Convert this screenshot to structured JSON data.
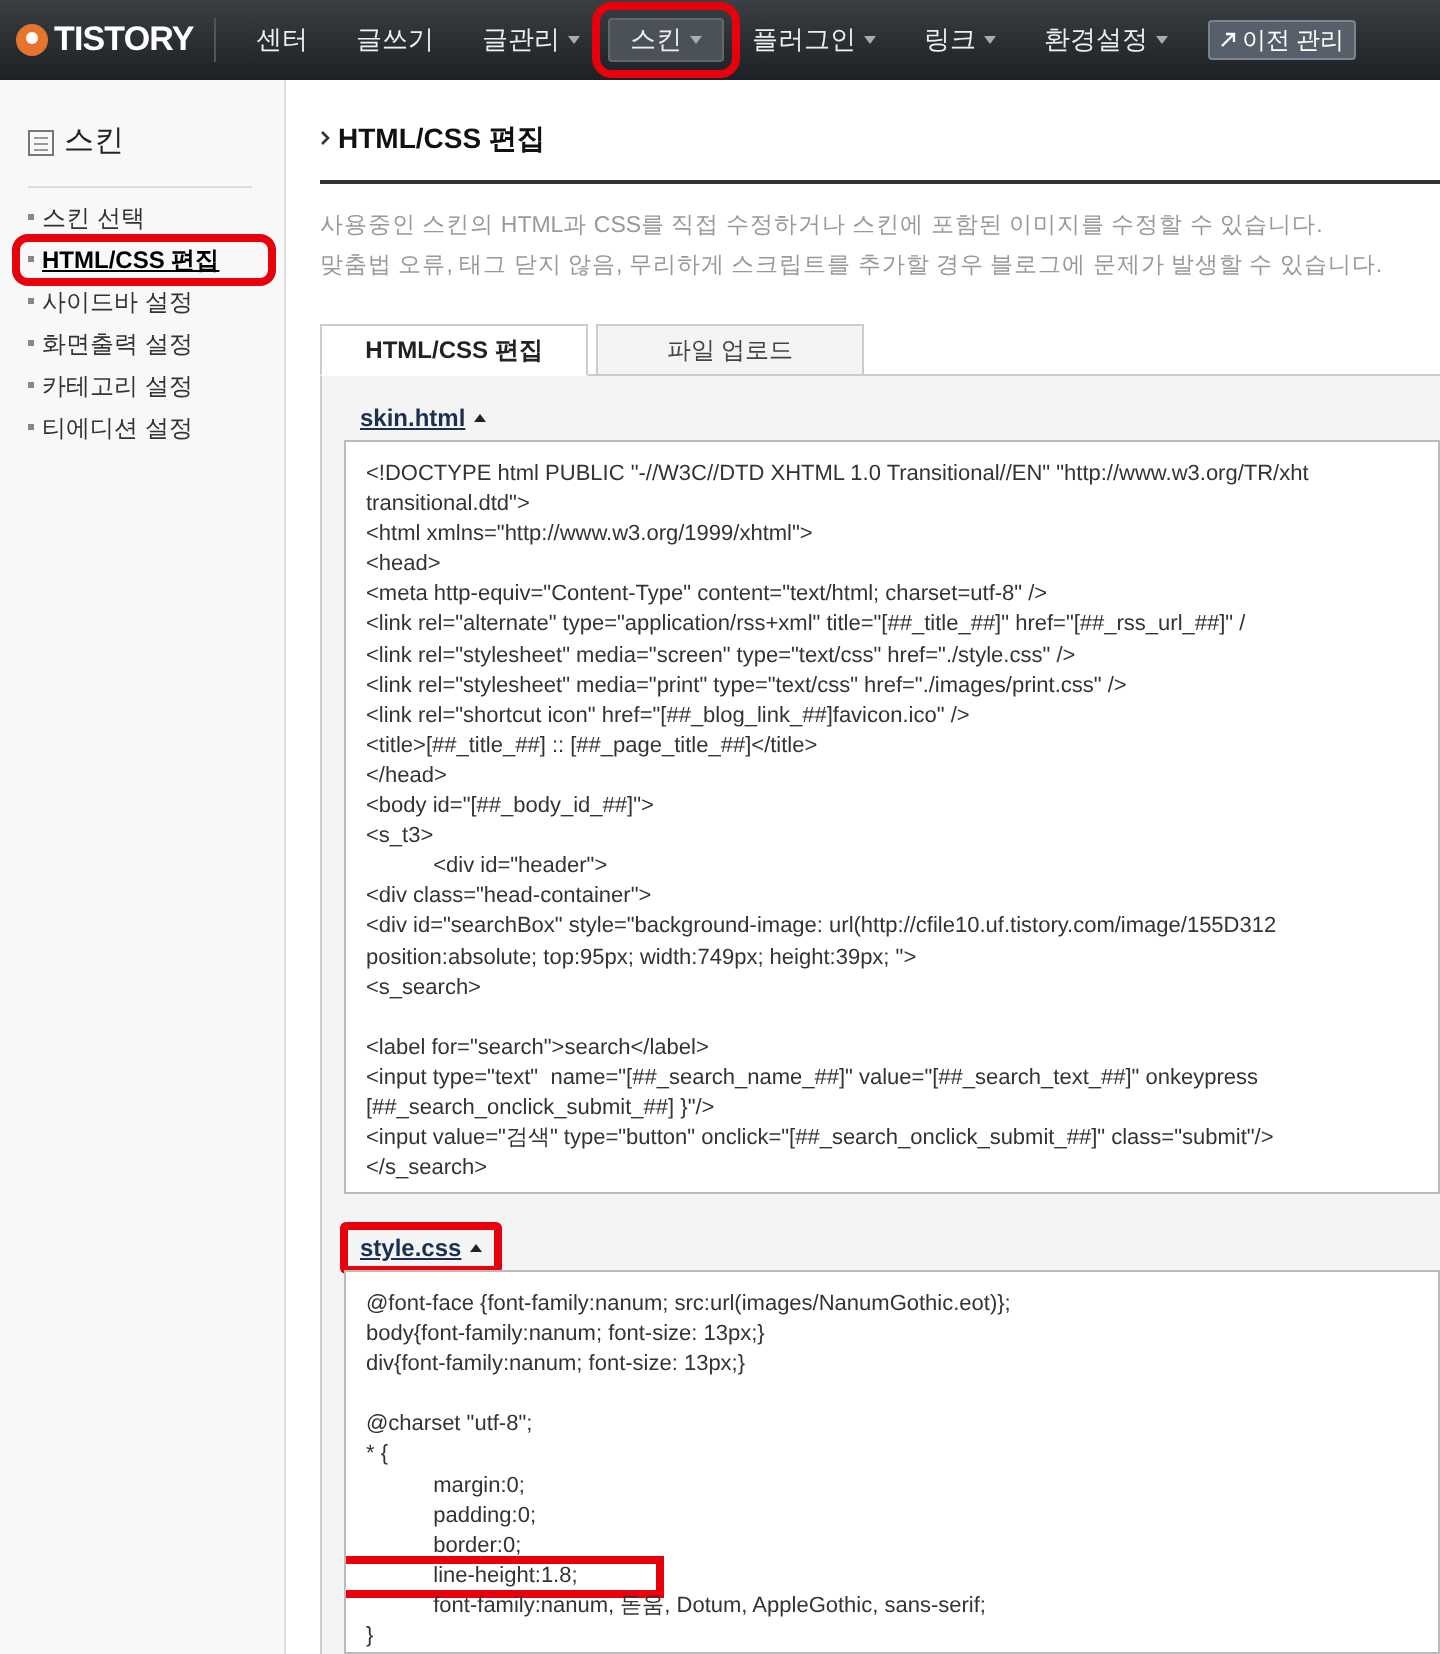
{
  "nav": {
    "logo": "TISTORY",
    "items": [
      {
        "label": "센터",
        "dropdown": false,
        "selected": false,
        "highlighted": false
      },
      {
        "label": "글쓰기",
        "dropdown": false,
        "selected": false,
        "highlighted": false
      },
      {
        "label": "글관리",
        "dropdown": true,
        "selected": false,
        "highlighted": false
      },
      {
        "label": "스킨",
        "dropdown": true,
        "selected": true,
        "highlighted": true
      },
      {
        "label": "플러그인",
        "dropdown": true,
        "selected": false,
        "highlighted": false
      },
      {
        "label": "링크",
        "dropdown": true,
        "selected": false,
        "highlighted": false
      },
      {
        "label": "환경설정",
        "dropdown": true,
        "selected": false,
        "highlighted": false
      }
    ],
    "legacy_button": "이전 관리"
  },
  "sidebar": {
    "title": "스킨",
    "items": [
      {
        "label": "스킨 선택",
        "selected": false,
        "highlighted": false
      },
      {
        "label": "HTML/CSS 편집",
        "selected": true,
        "highlighted": true
      },
      {
        "label": "사이드바 설정",
        "selected": false,
        "highlighted": false
      },
      {
        "label": "화면출력 설정",
        "selected": false,
        "highlighted": false
      },
      {
        "label": "카테고리 설정",
        "selected": false,
        "highlighted": false
      },
      {
        "label": "티에디션 설정",
        "selected": false,
        "highlighted": false
      }
    ]
  },
  "page": {
    "title": "HTML/CSS 편집",
    "description": [
      "사용중인 스킨의 HTML과 CSS를 직접 수정하거나 스킨에 포함된 이미지를 수정할 수 있습니다.",
      "맞춤법 오류, 태그 닫지 않음, 무리하게 스크립트를 추가할 경우 블로그에 문제가 발생할 수 있습니다."
    ],
    "tabs": [
      {
        "label": "HTML/CSS 편집",
        "selected": true
      },
      {
        "label": "파일 업로드",
        "selected": false
      }
    ],
    "sections": [
      {
        "file": "skin.html",
        "highlighted": false,
        "lines": [
          {
            "kind": "code",
            "text": "<!DOCTYPE html PUBLIC \"-//W3C//DTD XHTML 1.0 Transitional//EN\" \"http://www.w3.org/TR/xht",
            "highlighted": false
          },
          {
            "kind": "code",
            "text": "transitional.dtd\">",
            "highlighted": false
          },
          {
            "kind": "code",
            "text": "<html xmlns=\"http://www.w3.org/1999/xhtml\">",
            "highlighted": false
          },
          {
            "kind": "code",
            "text": "<head>",
            "highlighted": false
          },
          {
            "kind": "code",
            "text": "<meta http-equiv=\"Content-Type\" content=\"text/html; charset=utf-8\" />",
            "highlighted": false
          },
          {
            "kind": "code",
            "text": "<link rel=\"alternate\" type=\"application/rss+xml\" title=\"[##_title_##]\" href=\"[##_rss_url_##]\" /",
            "highlighted": false
          },
          {
            "kind": "code",
            "text": "<link rel=\"stylesheet\" media=\"screen\" type=\"text/css\" href=\"./style.css\" />",
            "highlighted": false
          },
          {
            "kind": "code",
            "text": "<link rel=\"stylesheet\" media=\"print\" type=\"text/css\" href=\"./images/print.css\" />",
            "highlighted": false
          },
          {
            "kind": "code",
            "text": "<link rel=\"shortcut icon\" href=\"[##_blog_link_##]favicon.ico\" />",
            "highlighted": false
          },
          {
            "kind": "code",
            "text": "<title>[##_title_##] :: [##_page_title_##]</title>",
            "highlighted": false
          },
          {
            "kind": "code",
            "text": "</head>",
            "highlighted": false
          },
          {
            "kind": "code",
            "text": "<body id=\"[##_body_id_##]\">",
            "highlighted": false
          },
          {
            "kind": "code",
            "text": "<s_t3>",
            "highlighted": false
          },
          {
            "kind": "code",
            "text": "\t<div id=\"header\">",
            "highlighted": false
          },
          {
            "kind": "code",
            "text": "<div class=\"head-container\">",
            "highlighted": false
          },
          {
            "kind": "code",
            "text": "<div id=\"searchBox\" style=\"background-image: url(http://cfile10.uf.tistory.com/image/155D312",
            "highlighted": false
          },
          {
            "kind": "code",
            "text": "position:absolute; top:95px; width:749px; height:39px; \">",
            "highlighted": false
          },
          {
            "kind": "code",
            "text": "<s_search>",
            "highlighted": false
          },
          {
            "kind": "blank"
          },
          {
            "kind": "code",
            "text": "<label for=\"search\">search</label>",
            "highlighted": false
          },
          {
            "kind": "code",
            "text": "<input type=\"text\"  name=\"[##_search_name_##]\" value=\"[##_search_text_##]\" onkeypress",
            "highlighted": false
          },
          {
            "kind": "code",
            "text": "[##_search_onclick_submit_##] }\"/>",
            "highlighted": false
          },
          {
            "kind": "code",
            "text": "<input value=\"검색\" type=\"button\" onclick=\"[##_search_onclick_submit_##]\" class=\"submit\"/>",
            "highlighted": false
          },
          {
            "kind": "code",
            "text": "</s_search>",
            "highlighted": false
          }
        ]
      },
      {
        "file": "style.css",
        "highlighted": true,
        "lines": [
          {
            "kind": "code",
            "text": "@font-face {font-family:nanum; src:url(images/NanumGothic.eot)};",
            "highlighted": false
          },
          {
            "kind": "code",
            "text": "body{font-family:nanum; font-size: 13px;}",
            "highlighted": false
          },
          {
            "kind": "code",
            "text": "div{font-family:nanum; font-size: 13px;}",
            "highlighted": false
          },
          {
            "kind": "blank"
          },
          {
            "kind": "code",
            "text": "@charset \"utf-8\";",
            "highlighted": false
          },
          {
            "kind": "code",
            "text": "* {",
            "highlighted": false
          },
          {
            "kind": "code",
            "text": "\tmargin:0;",
            "highlighted": false
          },
          {
            "kind": "code",
            "text": "\tpadding:0;",
            "highlighted": false
          },
          {
            "kind": "code",
            "text": "\tborder:0;",
            "highlighted": false
          },
          {
            "kind": "code",
            "text": "\tline-height:1.8;",
            "highlighted": true
          },
          {
            "kind": "code",
            "text": "\tfont-family:nanum, 돋움, Dotum, AppleGothic, sans-serif;",
            "highlighted": false
          },
          {
            "kind": "code",
            "text": "}",
            "highlighted": false
          }
        ]
      }
    ]
  }
}
